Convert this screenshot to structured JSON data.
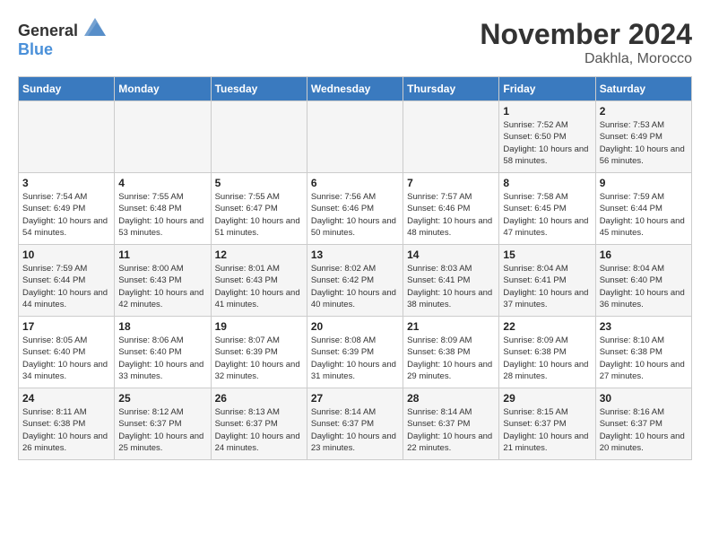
{
  "header": {
    "logo_general": "General",
    "logo_blue": "Blue",
    "month": "November 2024",
    "location": "Dakhla, Morocco"
  },
  "weekdays": [
    "Sunday",
    "Monday",
    "Tuesday",
    "Wednesday",
    "Thursday",
    "Friday",
    "Saturday"
  ],
  "weeks": [
    [
      {
        "day": "",
        "info": ""
      },
      {
        "day": "",
        "info": ""
      },
      {
        "day": "",
        "info": ""
      },
      {
        "day": "",
        "info": ""
      },
      {
        "day": "",
        "info": ""
      },
      {
        "day": "1",
        "info": "Sunrise: 7:52 AM\nSunset: 6:50 PM\nDaylight: 10 hours and 58 minutes."
      },
      {
        "day": "2",
        "info": "Sunrise: 7:53 AM\nSunset: 6:49 PM\nDaylight: 10 hours and 56 minutes."
      }
    ],
    [
      {
        "day": "3",
        "info": "Sunrise: 7:54 AM\nSunset: 6:49 PM\nDaylight: 10 hours and 54 minutes."
      },
      {
        "day": "4",
        "info": "Sunrise: 7:55 AM\nSunset: 6:48 PM\nDaylight: 10 hours and 53 minutes."
      },
      {
        "day": "5",
        "info": "Sunrise: 7:55 AM\nSunset: 6:47 PM\nDaylight: 10 hours and 51 minutes."
      },
      {
        "day": "6",
        "info": "Sunrise: 7:56 AM\nSunset: 6:46 PM\nDaylight: 10 hours and 50 minutes."
      },
      {
        "day": "7",
        "info": "Sunrise: 7:57 AM\nSunset: 6:46 PM\nDaylight: 10 hours and 48 minutes."
      },
      {
        "day": "8",
        "info": "Sunrise: 7:58 AM\nSunset: 6:45 PM\nDaylight: 10 hours and 47 minutes."
      },
      {
        "day": "9",
        "info": "Sunrise: 7:59 AM\nSunset: 6:44 PM\nDaylight: 10 hours and 45 minutes."
      }
    ],
    [
      {
        "day": "10",
        "info": "Sunrise: 7:59 AM\nSunset: 6:44 PM\nDaylight: 10 hours and 44 minutes."
      },
      {
        "day": "11",
        "info": "Sunrise: 8:00 AM\nSunset: 6:43 PM\nDaylight: 10 hours and 42 minutes."
      },
      {
        "day": "12",
        "info": "Sunrise: 8:01 AM\nSunset: 6:43 PM\nDaylight: 10 hours and 41 minutes."
      },
      {
        "day": "13",
        "info": "Sunrise: 8:02 AM\nSunset: 6:42 PM\nDaylight: 10 hours and 40 minutes."
      },
      {
        "day": "14",
        "info": "Sunrise: 8:03 AM\nSunset: 6:41 PM\nDaylight: 10 hours and 38 minutes."
      },
      {
        "day": "15",
        "info": "Sunrise: 8:04 AM\nSunset: 6:41 PM\nDaylight: 10 hours and 37 minutes."
      },
      {
        "day": "16",
        "info": "Sunrise: 8:04 AM\nSunset: 6:40 PM\nDaylight: 10 hours and 36 minutes."
      }
    ],
    [
      {
        "day": "17",
        "info": "Sunrise: 8:05 AM\nSunset: 6:40 PM\nDaylight: 10 hours and 34 minutes."
      },
      {
        "day": "18",
        "info": "Sunrise: 8:06 AM\nSunset: 6:40 PM\nDaylight: 10 hours and 33 minutes."
      },
      {
        "day": "19",
        "info": "Sunrise: 8:07 AM\nSunset: 6:39 PM\nDaylight: 10 hours and 32 minutes."
      },
      {
        "day": "20",
        "info": "Sunrise: 8:08 AM\nSunset: 6:39 PM\nDaylight: 10 hours and 31 minutes."
      },
      {
        "day": "21",
        "info": "Sunrise: 8:09 AM\nSunset: 6:38 PM\nDaylight: 10 hours and 29 minutes."
      },
      {
        "day": "22",
        "info": "Sunrise: 8:09 AM\nSunset: 6:38 PM\nDaylight: 10 hours and 28 minutes."
      },
      {
        "day": "23",
        "info": "Sunrise: 8:10 AM\nSunset: 6:38 PM\nDaylight: 10 hours and 27 minutes."
      }
    ],
    [
      {
        "day": "24",
        "info": "Sunrise: 8:11 AM\nSunset: 6:38 PM\nDaylight: 10 hours and 26 minutes."
      },
      {
        "day": "25",
        "info": "Sunrise: 8:12 AM\nSunset: 6:37 PM\nDaylight: 10 hours and 25 minutes."
      },
      {
        "day": "26",
        "info": "Sunrise: 8:13 AM\nSunset: 6:37 PM\nDaylight: 10 hours and 24 minutes."
      },
      {
        "day": "27",
        "info": "Sunrise: 8:14 AM\nSunset: 6:37 PM\nDaylight: 10 hours and 23 minutes."
      },
      {
        "day": "28",
        "info": "Sunrise: 8:14 AM\nSunset: 6:37 PM\nDaylight: 10 hours and 22 minutes."
      },
      {
        "day": "29",
        "info": "Sunrise: 8:15 AM\nSunset: 6:37 PM\nDaylight: 10 hours and 21 minutes."
      },
      {
        "day": "30",
        "info": "Sunrise: 8:16 AM\nSunset: 6:37 PM\nDaylight: 10 hours and 20 minutes."
      }
    ]
  ]
}
